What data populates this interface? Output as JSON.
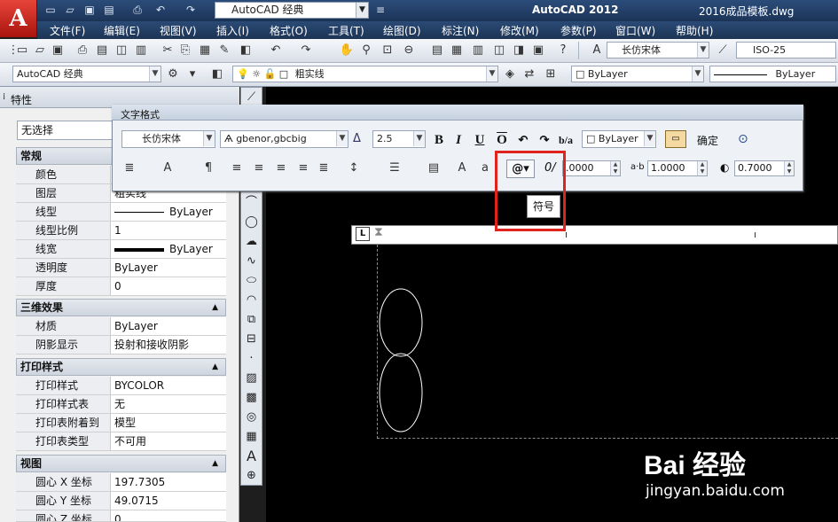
{
  "titlebar": {
    "workspace": "AutoCAD 经典",
    "app_name": "AutoCAD 2012",
    "file_name": "2016成品模板.dwg"
  },
  "menu": [
    "文件(F)",
    "编辑(E)",
    "视图(V)",
    "插入(I)",
    "格式(O)",
    "工具(T)",
    "绘图(D)",
    "标注(N)",
    "修改(M)",
    "参数(P)",
    "窗口(W)",
    "帮助(H)"
  ],
  "toolbar1": {
    "text_style": "长仿宋体",
    "dim_style": "ISO-25"
  },
  "toolbar2": {
    "workspace": "AutoCAD 经典",
    "layer": "粗实线",
    "color": "ByLayer",
    "linetype": "ByLayer"
  },
  "properties": {
    "title": "特性",
    "selection": "无选择",
    "sections": [
      {
        "title": "常规",
        "rows": [
          {
            "label": "颜色",
            "value": ""
          },
          {
            "label": "图层",
            "value": "粗实线"
          },
          {
            "label": "线型",
            "value": "ByLayer"
          },
          {
            "label": "线型比例",
            "value": "1"
          },
          {
            "label": "线宽",
            "value": "ByLayer"
          },
          {
            "label": "透明度",
            "value": "ByLayer"
          },
          {
            "label": "厚度",
            "value": "0"
          }
        ]
      },
      {
        "title": "三维效果",
        "rows": [
          {
            "label": "材质",
            "value": "ByLayer"
          },
          {
            "label": "阴影显示",
            "value": "投射和接收阴影"
          }
        ]
      },
      {
        "title": "打印样式",
        "rows": [
          {
            "label": "打印样式",
            "value": "BYCOLOR"
          },
          {
            "label": "打印样式表",
            "value": "无"
          },
          {
            "label": "打印表附着到",
            "value": "模型"
          },
          {
            "label": "打印表类型",
            "value": "不可用"
          }
        ]
      },
      {
        "title": "视图",
        "rows": [
          {
            "label": "圆心 X 坐标",
            "value": "197.7305"
          },
          {
            "label": "圆心 Y 坐标",
            "value": "49.0715"
          },
          {
            "label": "圆心 Z 坐标",
            "value": "0"
          }
        ]
      }
    ]
  },
  "text_format": {
    "title": "文字格式",
    "style": "长仿宋体",
    "font": "gbenor,gbcbig",
    "height": "2.5",
    "color": "ByLayer",
    "ok": "确定",
    "oblique": ".0000",
    "tracking": "1.0000",
    "width_factor": "0.7000",
    "symbol_tooltip": "符号"
  },
  "watermark": {
    "brand": "Bai 经验",
    "url": "jingyan.baidu.com"
  }
}
